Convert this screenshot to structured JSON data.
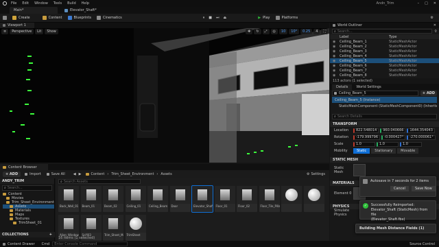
{
  "menu": {
    "items": [
      "File",
      "Edit",
      "Window",
      "Tools",
      "Build",
      "Help"
    ],
    "project_name": "Andn_Trim"
  },
  "tabs": {
    "level_tab": "Main*",
    "open_asset_tab": "Elevator_Shaft*"
  },
  "toolbar": {
    "save": "",
    "create": "Create",
    "content": "Content",
    "blueprints": "Blueprints",
    "cinematics": "Cinematics",
    "play": "Play",
    "platforms": "Platforms"
  },
  "viewport": {
    "tab_label": "Viewport 1",
    "perspective": "Perspective",
    "lit": "Lit",
    "grid_snap": "10",
    "rotation_snap": "10°",
    "scale_snap": "0.25",
    "camera_speed": "4"
  },
  "outliner": {
    "title": "World Outliner",
    "search_placeholder": "Search...",
    "col_label": "Label",
    "col_type": "Type",
    "rows": [
      {
        "label": "Ceiling_Beam_1",
        "type": "StaticMeshActor"
      },
      {
        "label": "Ceiling_Beam_2",
        "type": "StaticMeshActor"
      },
      {
        "label": "Ceiling_Beam_3",
        "type": "StaticMeshActor"
      },
      {
        "label": "Ceiling_Beam_4",
        "type": "StaticMeshActor"
      },
      {
        "label": "Ceiling_Beam_5",
        "type": "StaticMeshActor"
      },
      {
        "label": "Ceiling_Beam_6",
        "type": "StaticMeshActor"
      },
      {
        "label": "Ceiling_Beam_7",
        "type": "StaticMeshActor"
      },
      {
        "label": "Ceiling_Beam_8",
        "type": "StaticMeshActor"
      }
    ],
    "footer": "113 actors (1 selected)"
  },
  "details": {
    "tab_details": "Details",
    "tab_world": "World Settings",
    "actor_name": "Ceiling_Beam_5",
    "add_button": "+ ADD",
    "instance_label": "Ceiling_Beam_5 (Instance)",
    "component_label": "StaticMeshComponent (StaticMeshComponent0) (Inherited)",
    "search_placeholder": "Search Details",
    "transform_header": "TRANSFORM",
    "location_label": "Location",
    "location": [
      "822.548014",
      "960.040666",
      "1644.354043"
    ],
    "rotation_label": "Rotation",
    "rotation": [
      "-179.999796",
      "-0.000427°",
      "-270.000061°"
    ],
    "scale_label": "Scale",
    "scale": [
      "1.0",
      "1.0",
      "1.0"
    ],
    "mobility_label": "Mobility",
    "mobility_static": "Static",
    "mobility_stationary": "Stationary",
    "mobility_movable": "Movable",
    "static_mesh_header": "STATIC MESH",
    "static_mesh_label": "Static Mesh",
    "materials_header": "MATERIALS",
    "element_label": "Element 0",
    "physics_header": "PHYSICS",
    "simulate_label": "Simulate Physics"
  },
  "content_browser": {
    "tab_label": "Content Browser",
    "add": "+ ADD",
    "import": "Import",
    "save_all": "Save All",
    "breadcrumb": [
      "Content",
      "Trim_Sheet_Environment",
      "Assets"
    ],
    "settings": "Settings",
    "search_placeholder": "Search Assets",
    "tree_root": "ANDY_TRIM",
    "tree_search_placeholder": "Search...",
    "tree": [
      "Content",
      "Movies",
      "Trim_Sheet_Environment",
      "Assets",
      "Materials",
      "Maps",
      "Textures",
      "TrimSheet_01"
    ],
    "collections": "COLLECTIONS",
    "items_count": "16 items (1 selected)",
    "assets": [
      "Back_Wall_01",
      "Beam_01",
      "Beam_02",
      "Ceiling_01",
      "Ceiling_Beam",
      "Door",
      "Elevator_Shaft",
      "Floor_01",
      "Floor_02",
      "Floor_Tile_Pillar",
      "",
      "",
      "Alien_Window",
      "Scifi03",
      "Trim_Sheet_Material",
      "TrimSheet"
    ]
  },
  "toasts": {
    "autosave_text": "Autosave in 7 seconds for 2 items",
    "cancel": "Cancel",
    "save_now": "Save Now",
    "reimport_line1": "Successfully Reimported:",
    "reimport_line2": "Elevator_Shaft (StaticMesh) from file",
    "reimport_line3": "(Elevator_Shaft.fbx)",
    "distance_fields": "Building Mesh Distance Fields (1)"
  },
  "statusbar": {
    "content_drawer": "Content Drawer",
    "cmd": "Cmd",
    "console_placeholder": "Enter Console Command",
    "source_control": "Source Control"
  },
  "colors": {
    "accent_blue": "#0f6fd6",
    "play_green": "#2fbf3a",
    "selection": "#1c4f7a",
    "neon_green": "#3cff3c"
  }
}
